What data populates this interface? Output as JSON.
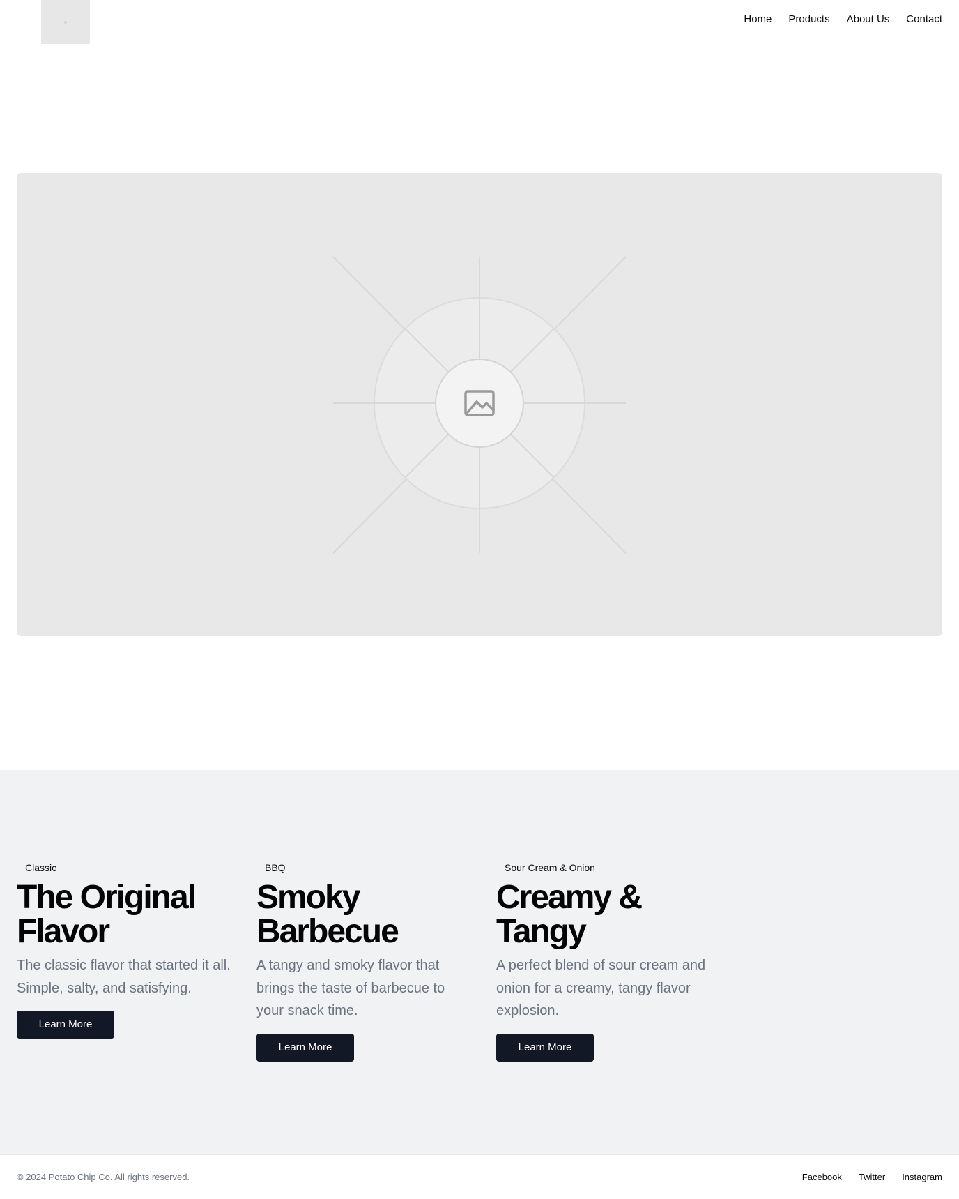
{
  "header": {
    "logo_icon": "image-placeholder-icon",
    "nav": [
      {
        "label": "Home"
      },
      {
        "label": "Products"
      },
      {
        "label": "About Us"
      },
      {
        "label": "Contact"
      }
    ]
  },
  "hero": {
    "image_icon": "image-icon"
  },
  "products": [
    {
      "tag": "Classic",
      "title": "The Original Flavor",
      "description": "The classic flavor that started it all. Simple, salty, and satisfying.",
      "button": "Learn More"
    },
    {
      "tag": "BBQ",
      "title": "Smoky Barbecue",
      "description": "A tangy and smoky flavor that brings the taste of barbecue to your snack time.",
      "button": "Learn More"
    },
    {
      "tag": "Sour Cream & Onion",
      "title": "Creamy & Tangy",
      "description": "A perfect blend of sour cream and onion for a creamy, tangy flavor explosion.",
      "button": "Learn More"
    }
  ],
  "footer": {
    "copyright": "© 2024 Potato Chip Co. All rights reserved.",
    "social": [
      {
        "label": "Facebook"
      },
      {
        "label": "Twitter"
      },
      {
        "label": "Instagram"
      }
    ]
  },
  "colors": {
    "button_bg": "#121826",
    "section_bg": "#f1f2f4",
    "placeholder_bg": "#e8e8e8",
    "muted_text": "#6b7280"
  }
}
